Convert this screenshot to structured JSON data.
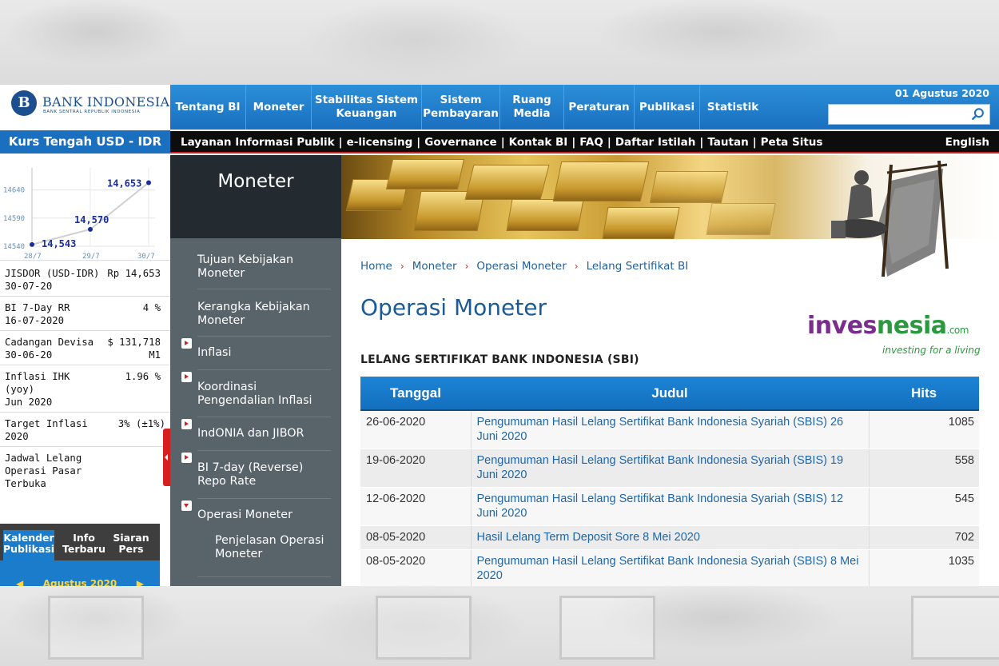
{
  "header": {
    "logo_title": "BANK INDONESIA",
    "logo_subtitle": "BANK SENTRAL REPUBLIK INDONESIA",
    "logo_mark": "B",
    "date": "01 Agustus 2020",
    "search_placeholder": "",
    "nav": [
      {
        "label": "Tentang BI"
      },
      {
        "label": "Moneter"
      },
      {
        "label": "Stabilitas Sistem Keuangan"
      },
      {
        "label": "Sistem Pembayaran"
      },
      {
        "label": "Ruang Media"
      },
      {
        "label": "Peraturan"
      },
      {
        "label": "Publikasi"
      },
      {
        "label": "Statistik"
      }
    ],
    "utility_links": [
      "Layanan Informasi Publik",
      "e-licensing",
      "Governance",
      "Kontak BI",
      "FAQ",
      "Daftar Istilah",
      "Tautan",
      "Peta Situs"
    ],
    "language": "English",
    "colors": {
      "nav_blue": "#1a6fbf",
      "accent_red": "#c22222"
    }
  },
  "kurs": {
    "title": "Kurs Tengah USD - IDR",
    "chart_data": {
      "type": "line",
      "x": [
        "28/7",
        "29/7",
        "30/7"
      ],
      "values": [
        14543,
        14570,
        14653
      ],
      "data_labels": [
        "14,543",
        "14,570",
        "14,653"
      ],
      "yticks": [
        "14640",
        "14590",
        "14540"
      ],
      "grid": true
    }
  },
  "stats": [
    {
      "label": "JISDOR (USD-IDR)",
      "sub": "30-07-20",
      "value": "Rp 14,653"
    },
    {
      "label": "BI 7-Day RR",
      "sub": "16-07-2020",
      "value": "4 %"
    },
    {
      "label": "Cadangan Devisa",
      "sub": "30-06-20",
      "value": "$ 131,718",
      "value2": "M1"
    },
    {
      "label": "Inflasi IHK (yoy)",
      "sub": "Jun 2020",
      "value": "1.96 %"
    },
    {
      "label": "Target Inflasi",
      "sub": "2020",
      "value": "3% (±1%)"
    },
    {
      "label": "Jadwal Lelang Operasi Pasar Terbuka",
      "sub": "",
      "value": ""
    }
  ],
  "kalender": {
    "tabs": [
      {
        "label1": "Kalender",
        "label2": "Publikasi"
      },
      {
        "label1": "Info",
        "label2": "Terbaru"
      },
      {
        "label1": "Siaran",
        "label2": "Pers"
      }
    ],
    "month": "Agustus 2020"
  },
  "side": {
    "title": "Moneter",
    "items": [
      {
        "label": "Tujuan Kebijakan Moneter",
        "bullet": "none"
      },
      {
        "label": "Kerangka Kebijakan Moneter",
        "bullet": "none"
      },
      {
        "label": "Inflasi",
        "bullet": "right"
      },
      {
        "label": "Koordinasi Pengendalian Inflasi",
        "bullet": "right"
      },
      {
        "label": "IndONIA dan JIBOR",
        "bullet": "right"
      },
      {
        "label": "BI 7-day (Reverse) Repo Rate",
        "bullet": "right"
      },
      {
        "label": "Operasi Moneter",
        "bullet": "down"
      }
    ],
    "sub_item": "Penjelasan Operasi Moneter"
  },
  "content": {
    "breadcrumb": [
      "Home",
      "Moneter",
      "Operasi Moneter",
      "Lelang Sertifikat BI"
    ],
    "title": "Operasi Moneter",
    "section_title": "LELANG SERTIFIKAT BANK INDONESIA (SBI)",
    "watermark": {
      "part1": "inves",
      "part2": "nesia",
      "suffix": ".com",
      "tagline": "investing for a living"
    },
    "table": {
      "headers": [
        "Tanggal",
        "Judul",
        "Hits"
      ],
      "rows": [
        {
          "date": "26-06-2020",
          "title": "Pengumuman Hasil Lelang Sertifikat Bank Indonesia Syariah (SBIS) 26 Juni 2020",
          "hits": "1085"
        },
        {
          "date": "19-06-2020",
          "title": "Pengumuman Hasil Lelang Sertifikat Bank Indonesia Syariah (SBIS) 19 Juni 2020",
          "hits": "558"
        },
        {
          "date": "12-06-2020",
          "title": "Pengumuman Hasil Lelang Sertifikat Bank Indonesia Syariah (SBIS) 12 Juni 2020",
          "hits": "545"
        },
        {
          "date": "08-05-2020",
          "title": "Hasil Lelang Term Deposit Sore 8 Mei 2020",
          "hits": "702"
        },
        {
          "date": "08-05-2020",
          "title": "Pengumuman Hasil Lelang Sertifikat Bank Indonesia Syariah (SBIS) 8 Mei 2020",
          "hits": "1035"
        }
      ]
    }
  }
}
